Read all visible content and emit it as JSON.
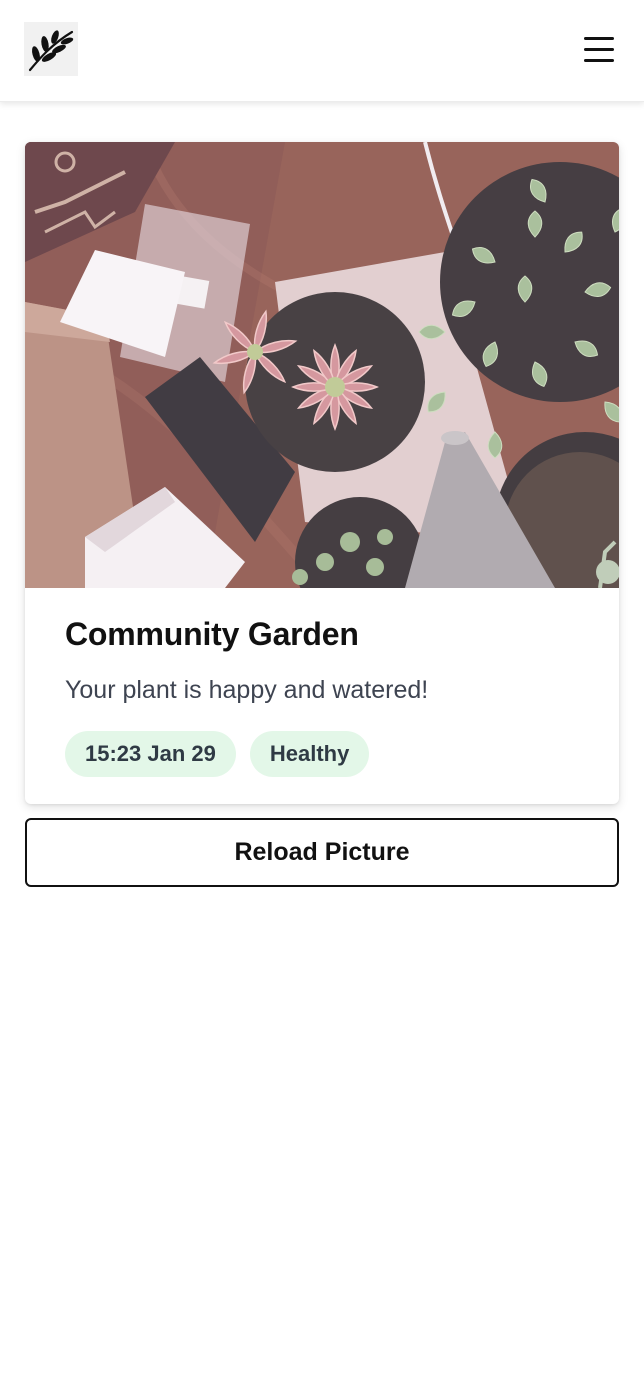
{
  "header": {
    "logo_icon": "leaf-branch-icon",
    "menu_icon": "hamburger-menu-icon"
  },
  "card": {
    "image_alt": "",
    "title": "Community Garden",
    "status_message": "Your plant is happy and watered!",
    "tags": [
      {
        "label": "15:23 Jan 29"
      },
      {
        "label": "Healthy"
      }
    ],
    "tag_background": "#e3f7e8"
  },
  "actions": {
    "reload_label": "Reload Picture"
  }
}
